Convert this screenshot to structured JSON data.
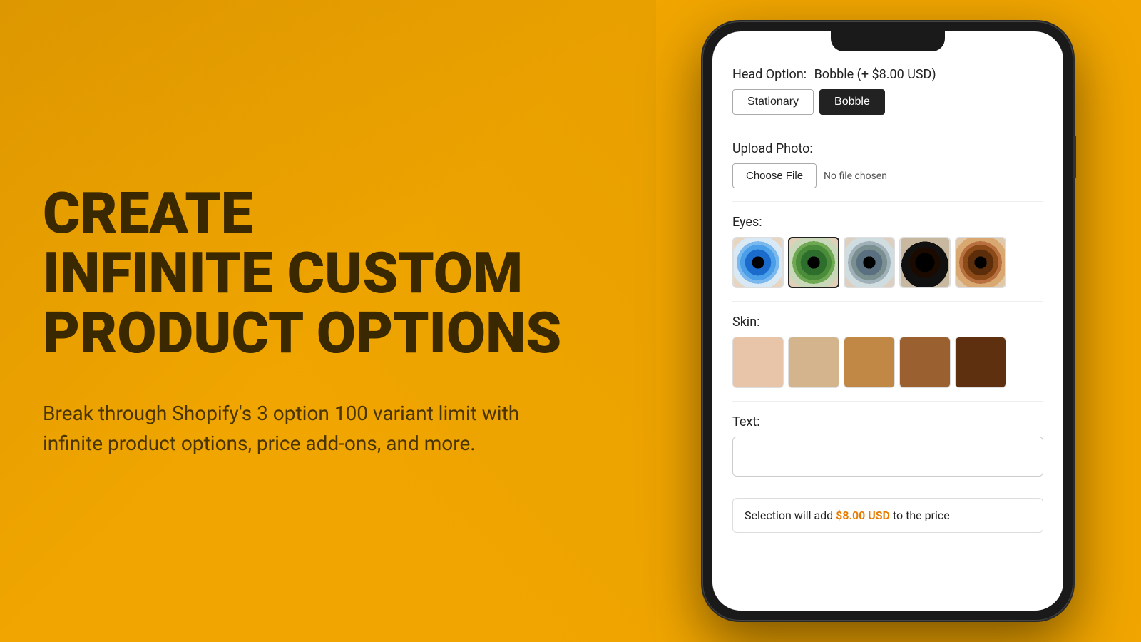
{
  "left": {
    "title_line1": "CREATE",
    "title_line2": "INFINITE CUSTOM",
    "title_line3": "PRODUCT OPTIONS",
    "subtitle": "Break through Shopify's 3 option 100 variant limit with infinite product options, price add-ons, and more."
  },
  "phone": {
    "head_option_label": "Head Option:",
    "head_option_value": "Bobble  (+ $8.00 USD)",
    "head_options": [
      {
        "label": "Stationary",
        "active": false
      },
      {
        "label": "Bobble",
        "active": true
      }
    ],
    "upload_label": "Upload Photo:",
    "choose_file_label": "Choose File",
    "no_file_label": "No file chosen",
    "eyes_label": "Eyes:",
    "eyes": [
      {
        "type": "blue",
        "selected": false
      },
      {
        "type": "green",
        "selected": true
      },
      {
        "type": "grey",
        "selected": false
      },
      {
        "type": "dark",
        "selected": false
      },
      {
        "type": "brown",
        "selected": false
      }
    ],
    "skin_label": "Skin:",
    "skin_colors": [
      "#E8C4A8",
      "#D4B48C",
      "#C08844",
      "#9A6030",
      "#5E3010"
    ],
    "text_label": "Text:",
    "text_placeholder": "",
    "price_notice": "Selection will add ",
    "price_value": "$8.00 USD",
    "price_suffix": " to the price"
  }
}
